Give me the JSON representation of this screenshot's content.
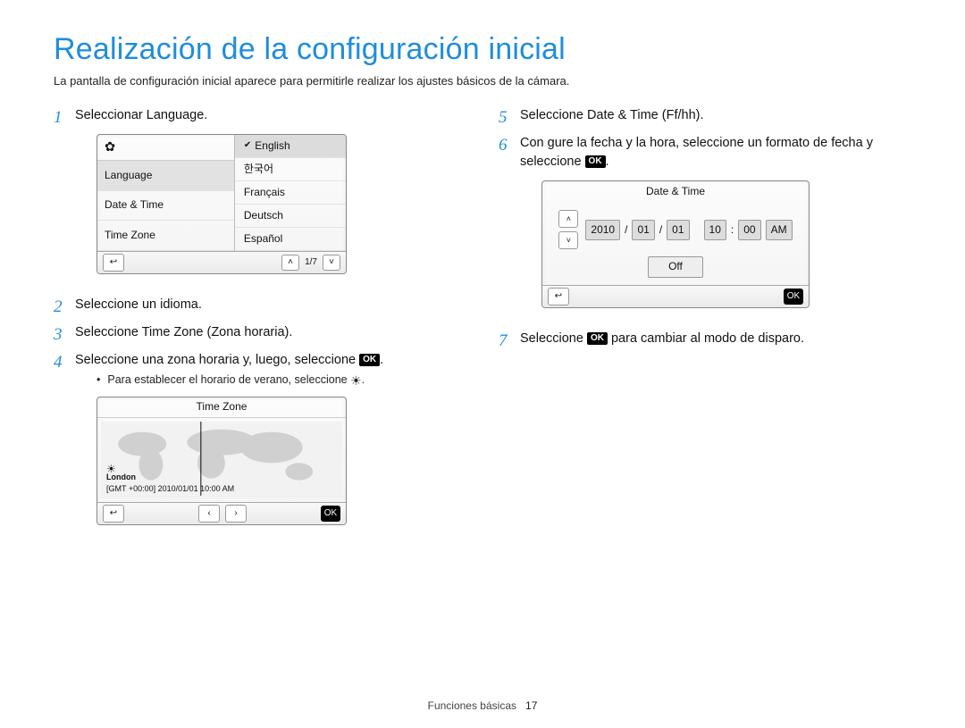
{
  "title": "Realización de la configuración inicial",
  "intro": "La pantalla de configuración inicial aparece para permitirle realizar los ajustes básicos de la cámara.",
  "left_steps": {
    "s1": "Seleccionar Language.",
    "s2": "Seleccione un idioma.",
    "s3": "Seleccione Time Zone (Zona horaria).",
    "s4_pre": "Seleccione una zona horaria y, luego, seleccione ",
    "s4_ok": "OK",
    "s4_post": ".",
    "s4_sub_pre": "Para establecer el horario de verano, seleccione ",
    "s4_sub_icon": "☀",
    "s4_sub_post": "."
  },
  "right_steps": {
    "s5": "Seleccione Date & Time (Ff/hh).",
    "s6_pre": "Con  gure la fecha y la hora, seleccione un formato de fecha y seleccione ",
    "s6_ok": "OK",
    "s6_post": ".",
    "s7_pre": "Seleccione ",
    "s7_ok": "OK",
    "s7_post": " para cambiar al modo de disparo."
  },
  "lang_screen": {
    "gear": "✿",
    "menu": [
      "Language",
      "Date & Time",
      "Time Zone"
    ],
    "menu_selected": 0,
    "options": [
      "English",
      "한국어",
      "Français",
      "Deutsch",
      "Español"
    ],
    "option_selected": 0,
    "back": "↩",
    "page": "1/7",
    "up": "˄",
    "down": "˅"
  },
  "tz_screen": {
    "title": "Time Zone",
    "city": "London",
    "gmt_line": "[GMT +00:00] 2010/01/01 10:00 AM",
    "back": "↩",
    "left": "‹",
    "right": "›",
    "ok": "OK",
    "sun": "☀"
  },
  "dt_screen": {
    "title": "Date & Time",
    "year": "2010",
    "month": "01",
    "day": "01",
    "hour": "10",
    "minute": "00",
    "ampm": "AM",
    "off": "Off",
    "up": "˄",
    "down": "˅",
    "back": "↩",
    "ok": "OK",
    "slash": "/",
    "colon": ":"
  },
  "footer": {
    "section": "Funciones básicas",
    "page": "17"
  }
}
